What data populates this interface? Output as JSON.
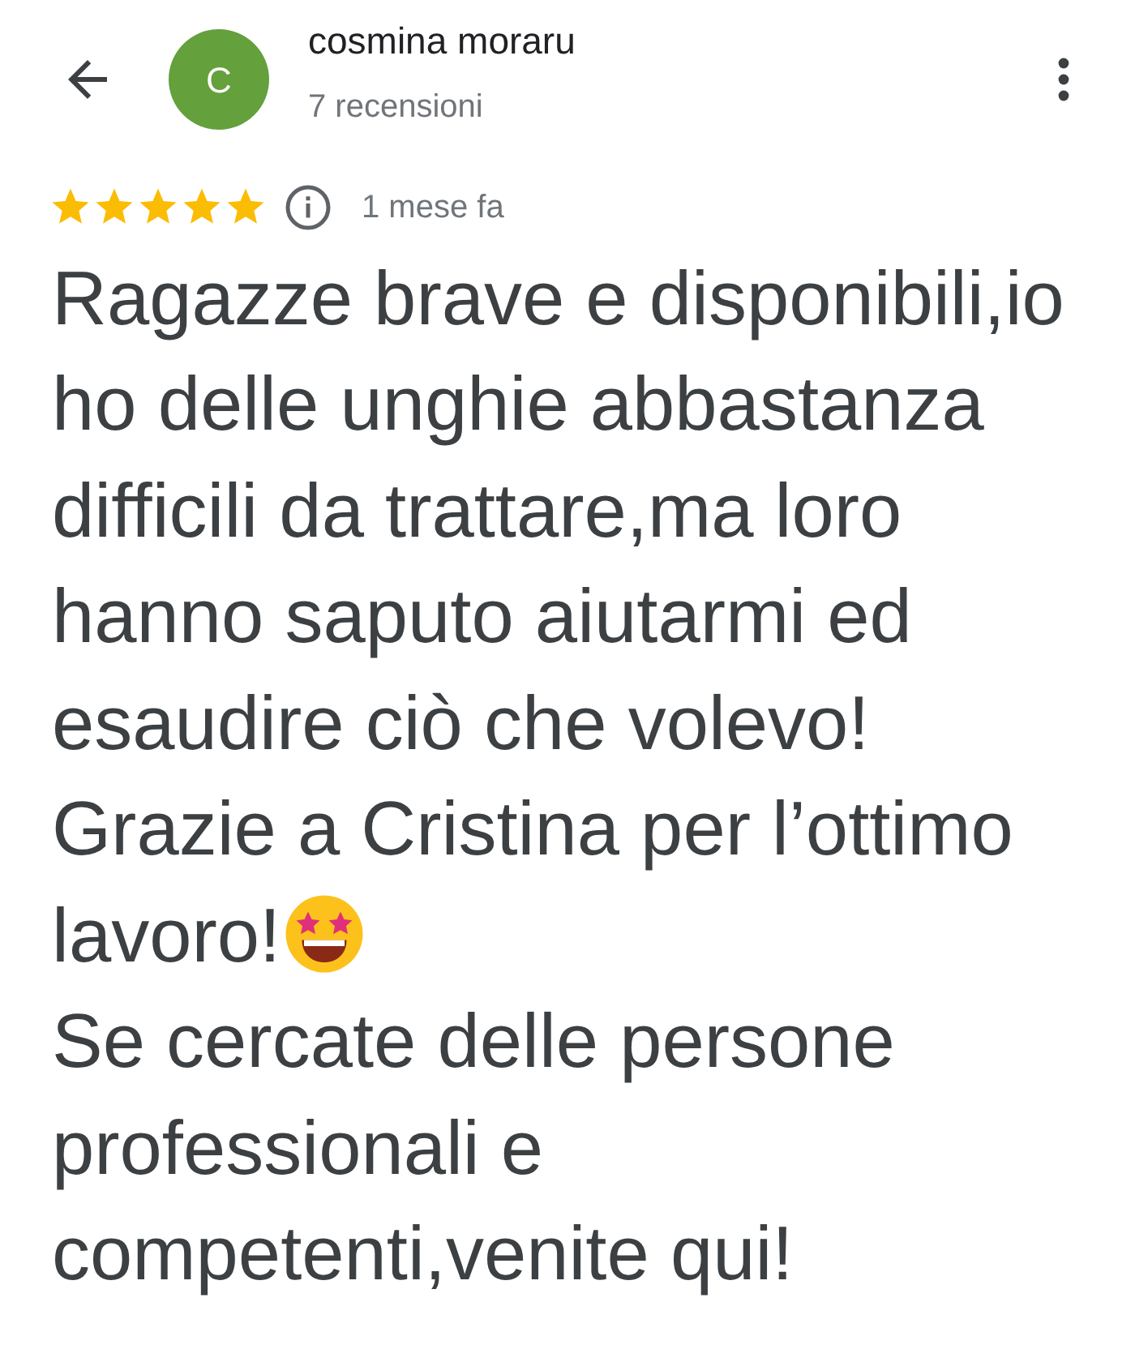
{
  "reviewer": {
    "initial": "C",
    "name": "cosmina moraru",
    "reviews": "7 recensioni"
  },
  "review": {
    "stars": 5,
    "time": "1 mese fa",
    "lines": [
      {
        "text": "Ragazze brave e disponibili,io",
        "emoji": false
      },
      {
        "text": "ho delle unghie abbastanza",
        "emoji": false
      },
      {
        "text": "difficili da trattare,ma loro",
        "emoji": false
      },
      {
        "text": "hanno saputo aiutarmi ed",
        "emoji": false
      },
      {
        "text": "esaudire ciò che volevo!",
        "emoji": false
      },
      {
        "text": "Grazie a Cristina per l’ottimo",
        "emoji": false
      },
      {
        "text": "lavoro!",
        "emoji": true
      },
      {
        "text": "Se cercate delle persone",
        "emoji": false
      },
      {
        "text": "professionali e",
        "emoji": false
      },
      {
        "text": "competenti,venite qui!",
        "emoji": false
      }
    ]
  }
}
